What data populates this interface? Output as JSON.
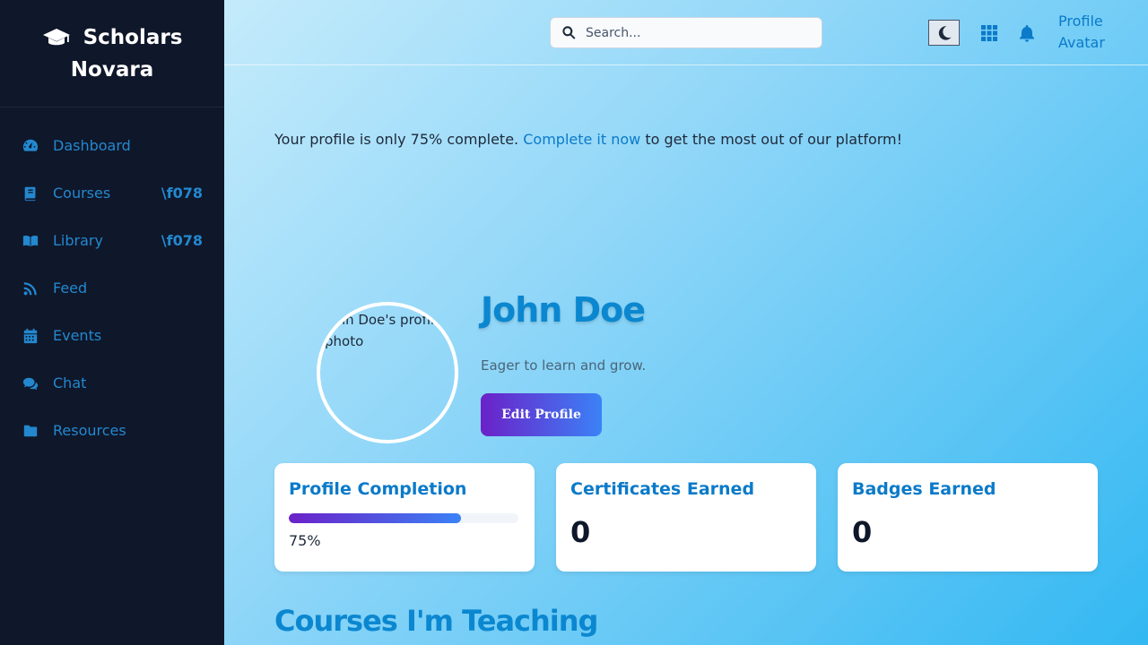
{
  "brand": {
    "line1": "Scholars",
    "line2": "Novara"
  },
  "sidebar": {
    "items": [
      {
        "label": "Dashboard",
        "icon": "gauge-icon",
        "extra": ""
      },
      {
        "label": "Courses",
        "icon": "book-icon",
        "extra": "\\f078"
      },
      {
        "label": "Library",
        "icon": "book-open-icon",
        "extra": "\\f078"
      },
      {
        "label": "Feed",
        "icon": "rss-icon",
        "extra": ""
      },
      {
        "label": "Events",
        "icon": "calendar-icon",
        "extra": ""
      },
      {
        "label": "Chat",
        "icon": "comments-icon",
        "extra": ""
      },
      {
        "label": "Resources",
        "icon": "folder-icon",
        "extra": ""
      }
    ]
  },
  "header": {
    "search_placeholder": "Search...",
    "avatar_alt": "Profile Avatar"
  },
  "notice": {
    "prefix": "Your profile is only 75% complete.",
    "link": "Complete it now",
    "suffix": "to get the most out of our platform!"
  },
  "profile": {
    "photo_alt": "John Doe's profile photo",
    "name": "John Doe",
    "bio": "Eager to learn and grow.",
    "edit_label": "Edit Profile"
  },
  "cards": {
    "completion": {
      "title": "Profile Completion",
      "percent_text": "75%",
      "progress": 0.75
    },
    "certificates": {
      "title": "Certificates Earned",
      "value": "0"
    },
    "badges": {
      "title": "Badges Earned",
      "value": "0"
    }
  },
  "section": {
    "title": "Courses I'm Teaching"
  },
  "colors": {
    "accent": "#0b87d0",
    "sidebar_bg": "#0f172a",
    "gradient_start": "#6b21c8",
    "gradient_end": "#3b82f6"
  }
}
